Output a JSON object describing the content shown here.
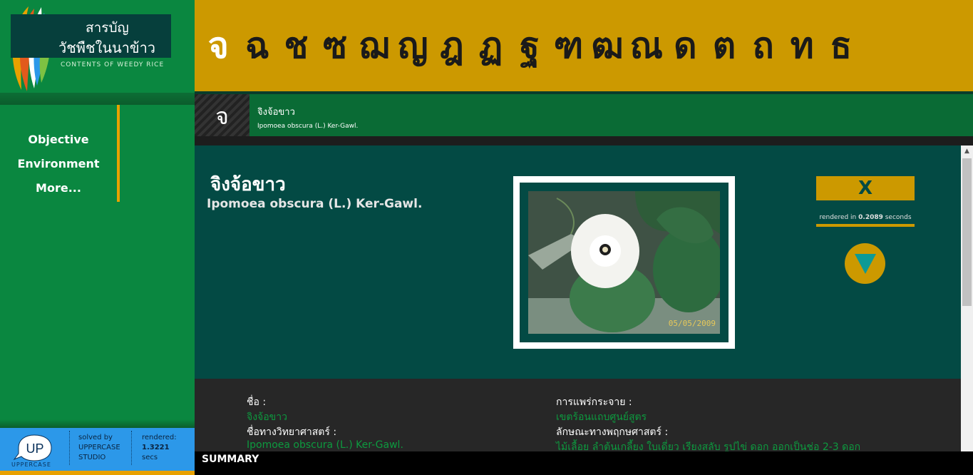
{
  "logo": {
    "title_line1": "สารบัญ",
    "title_line2": "วัชพืชในนาข้าว",
    "subtitle": "CONTENTS OF WEEDY RICE"
  },
  "nav": {
    "items": [
      {
        "label": "Objective"
      },
      {
        "label": "Environment"
      },
      {
        "label": "More..."
      }
    ]
  },
  "footer": {
    "up_label": "UP",
    "up_caption": "UPPERCASE",
    "solved_line1": "solved by",
    "solved_line2": "UPPERCASE",
    "solved_line3": "STUDIO",
    "rendered_label": "rendered:",
    "rendered_value": "1.3221",
    "rendered_unit": "secs"
  },
  "alphabet": [
    "จ",
    "ฉ",
    "ช",
    "ซ",
    "ฌ",
    "ญ",
    "ฎ",
    "ฏ",
    "ฐ",
    "ฑ",
    "ฒ",
    "ณ",
    "ด",
    "ต",
    "ถ",
    "ท",
    "ธ"
  ],
  "alphabet_active_index": 0,
  "crumb": {
    "letter": "จ",
    "name": "จิงจ้อขาว",
    "scientific": "Ipomoea obscura (L.) Ker-Gawl."
  },
  "plant": {
    "name": "จิงจ้อขาว",
    "scientific": "Ipomoea obscura (L.) Ker-Gawl.",
    "photo_date": "05/05/2009"
  },
  "actions": {
    "close_label": "X",
    "render_prefix": "rendered in ",
    "render_time": "0.2089",
    "render_suffix": " seconds"
  },
  "info": {
    "left": [
      {
        "label": "ชื่อ :",
        "value": "จิงจ้อขาว"
      },
      {
        "label": "ชื่อทางวิทยาศาสตร์ :",
        "value": "Ipomoea obscura (L.) Ker-Gawl."
      }
    ],
    "right": [
      {
        "label": "การแพร่กระจาย :",
        "value": "เขตร้อนแถบศูนย์สูตร"
      },
      {
        "label": "ลักษณะทางพฤกษศาสตร์ :",
        "value": "ไม้เลื้อย ลำต้นเกลี้ยง ใบเดี่ยว เรียงสลับ รูปไข่ ดอก ออกเป็นช่อ 2-3 ดอก"
      }
    ]
  },
  "summary_label": "SUMMARY",
  "colors": {
    "sidebar_green": "#0a8740",
    "gold": "#cc9900",
    "dark_teal": "#034a44",
    "info_green": "#0d9a3f",
    "footer_blue": "#2c98e9"
  }
}
